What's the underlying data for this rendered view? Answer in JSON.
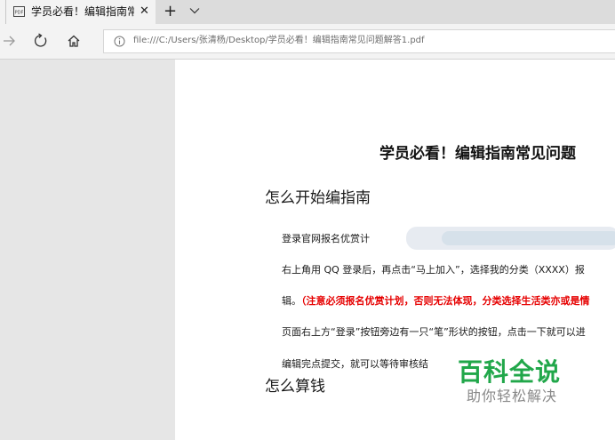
{
  "tab": {
    "title": "学员必看！编辑指南常!",
    "close": "✕"
  },
  "tabbar": {
    "new_tab": "+"
  },
  "address": {
    "url": "file:///C:/Users/张清杨/Desktop/学员必看！编辑指南常见问题解答1.pdf"
  },
  "document": {
    "title": "学员必看！编辑指南常见问题",
    "section1": "怎么开始编指南",
    "lines": [
      "登录官网报名优赏计",
      "右上角用 QQ 登录后，再点击“马上加入”，选择我的分类（XXXX）报",
      "页面右上方“登录”按钮旁边有一只“笔”形状的按钮，点击一下就可以进",
      "编辑完点提交，就可以等待审核结"
    ],
    "line3_prefix": "辑。",
    "line3_red": "（注意必须报名优赏计划，否则无法体现，分类选择生活类亦或是情",
    "section2": "怎么算钱"
  },
  "watermark": {
    "title": "百科全说",
    "subtitle": "助你轻松解决"
  },
  "colors": {
    "accent_red": "#e60000",
    "watermark_green": "#21a74a"
  }
}
